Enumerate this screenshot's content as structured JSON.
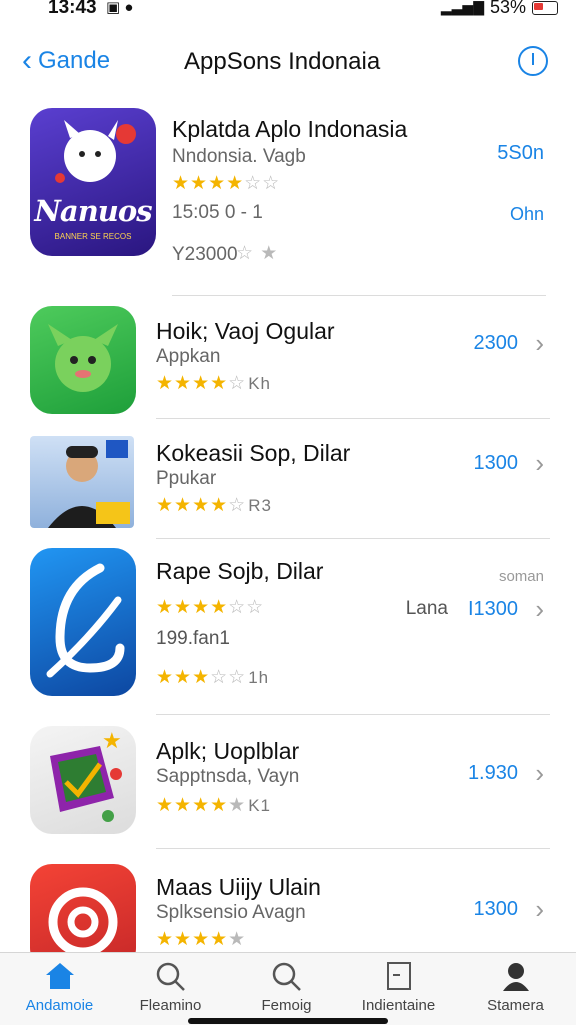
{
  "status": {
    "time": "13:43",
    "battery": "53%"
  },
  "nav": {
    "back_label": "Gande",
    "title": "AppSons Indonaia"
  },
  "featured": {
    "name": "Kplatda Aplo Indonasia",
    "subtitle": "Nndonsia. Vagb",
    "rating_stars": 3.5,
    "date": "15:05 0 - 1",
    "reviews": "Y23000",
    "price_top": "5S0n",
    "price_mid": "Ohn",
    "icon_text": "Nanuos",
    "icon_subtext": "BANNER SE RECOS"
  },
  "apps": [
    {
      "name": "Hoik; Vaoj Ogular",
      "subtitle": "Appkan",
      "rating_stars": 3.5,
      "rating_suffix": "Kh",
      "price": "2300"
    },
    {
      "name": "Kokeasii Sop, Dilar",
      "subtitle": "Ppukar",
      "rating_stars": 3.5,
      "rating_suffix": "R3",
      "price": "1300"
    },
    {
      "name": "Rape Sojb, Dilar",
      "subtitle": "",
      "rating_stars": 3,
      "rating_suffix": "",
      "price_prefix": "Lana",
      "price": "I1300",
      "top_right_small": "soman",
      "meta_line": "199.fan1",
      "second_stars": 2.5,
      "second_suffix": "1h"
    },
    {
      "name": "Aplk; Uoplblar",
      "subtitle": "Sapptnsda, Vayn",
      "rating_stars": 4,
      "rating_suffix": "K1",
      "price": "1.930"
    },
    {
      "name": "Maas Uiijy Ulain",
      "subtitle": "Splksensio Avagn",
      "rating_stars": 3.5,
      "rating_suffix": "",
      "price": "1300"
    }
  ],
  "tabs": [
    {
      "label": "Andamoie",
      "icon": "home-icon",
      "active": true
    },
    {
      "label": "Fleamino",
      "icon": "search-icon",
      "active": false
    },
    {
      "label": "Femoig",
      "icon": "search-icon",
      "active": false
    },
    {
      "label": "Indientaine",
      "icon": "document-icon",
      "active": false
    },
    {
      "label": "Stamera",
      "icon": "profile-icon",
      "active": false
    }
  ]
}
